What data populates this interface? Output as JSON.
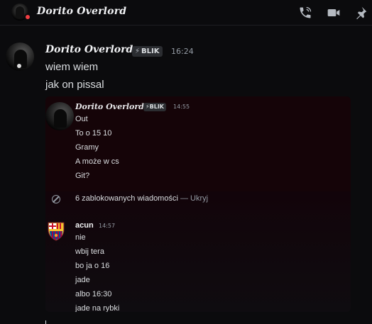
{
  "channel": {
    "title": "Dorito Overlord"
  },
  "header_icons": {
    "call": "phone-icon",
    "video": "video-camera-icon",
    "pin": "pin-icon"
  },
  "message": {
    "author": "Dorito Overlord",
    "tag_icon": "⚡",
    "tag": "BLIK",
    "time": "16:24",
    "lines": [
      "wiem wiem",
      "jak on pissal"
    ]
  },
  "forwarded": {
    "author": "Dorito Overlord",
    "tag_icon": "⚡",
    "tag": "BLIK",
    "time": "14:55",
    "lines": [
      "Out",
      "To o 15 10",
      "Gramy",
      "A może w cs",
      "Git?"
    ],
    "blocked": {
      "text": "6 zablokowanych wiadomości",
      "separator": "—",
      "action": "Ukryj"
    },
    "reply": {
      "author": "acun",
      "time": "14:57",
      "lines": [
        "nie",
        "wbij tera",
        "bo ja o 16",
        "jade",
        "albo 16:30",
        "jade na rybki"
      ]
    }
  },
  "colors": {
    "background": "#0b0b0d",
    "text": "#dbdee1",
    "muted": "#949ba4",
    "dnd_status": "#f23f43",
    "embed_bg": "#150408"
  }
}
